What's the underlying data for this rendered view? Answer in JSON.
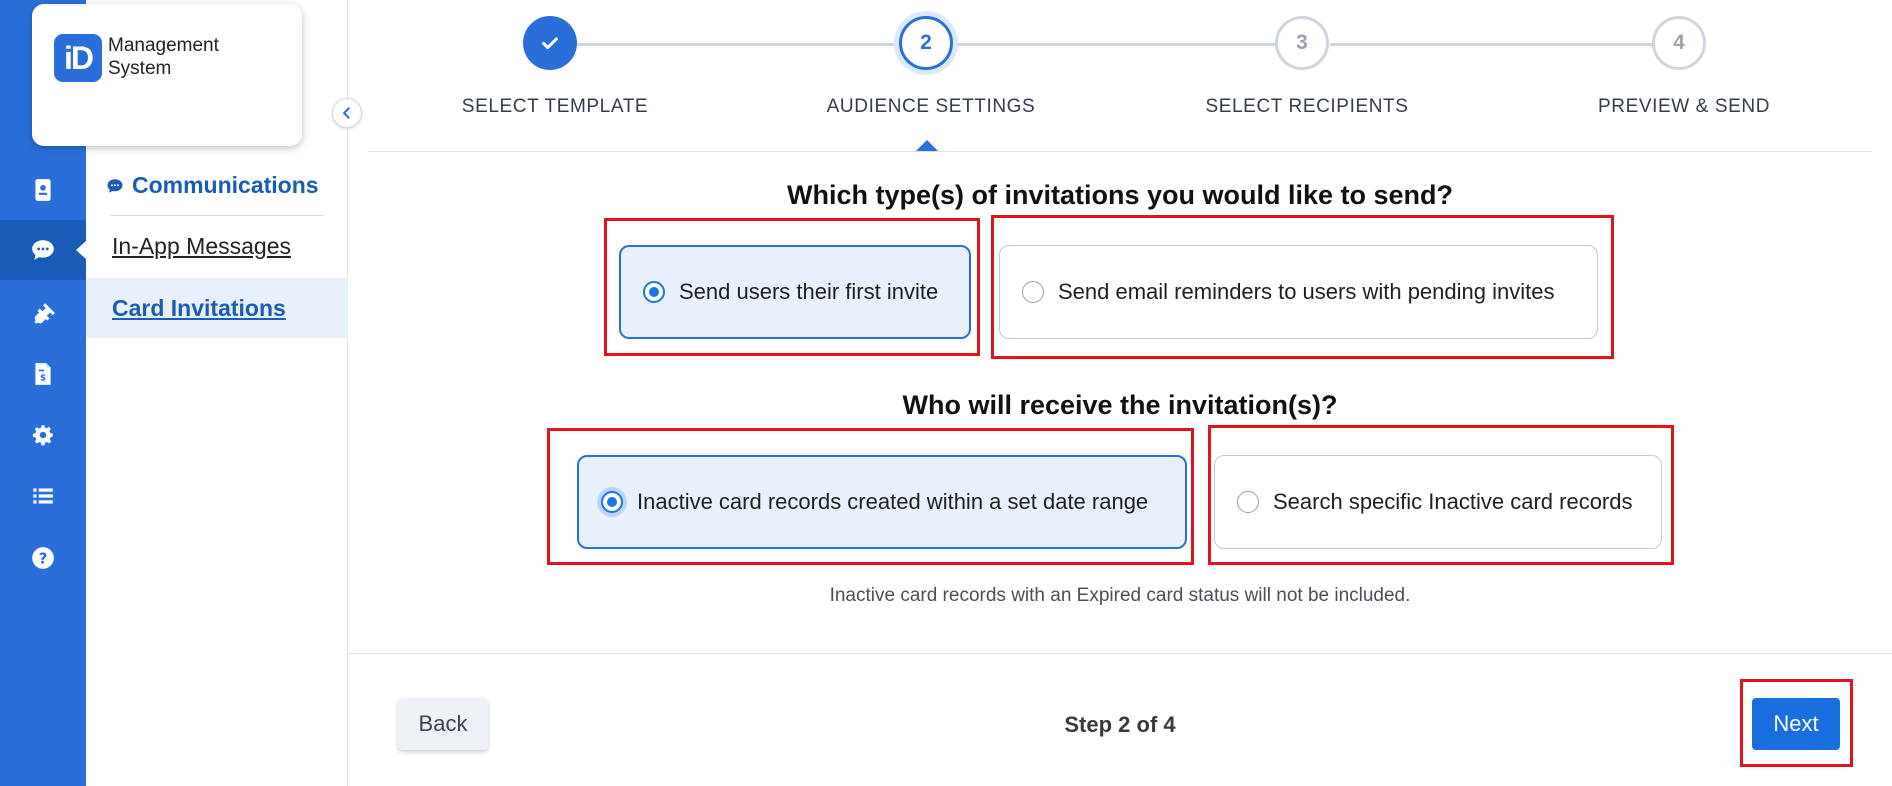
{
  "logo": {
    "badge": "iD",
    "line1": "Management",
    "line2": "System"
  },
  "rail": {
    "items": [
      {
        "icon": "id-card-icon",
        "active": false
      },
      {
        "icon": "chat-bubble-icon",
        "active": true
      },
      {
        "icon": "plug-icon",
        "active": false
      },
      {
        "icon": "invoice-icon",
        "active": false
      },
      {
        "icon": "gear-icon",
        "active": false
      },
      {
        "icon": "list-icon",
        "active": false
      },
      {
        "icon": "help-icon",
        "active": false
      }
    ]
  },
  "subnav": {
    "header": "Communications",
    "items": [
      {
        "label": "In-App Messages",
        "active": false
      },
      {
        "label": "Card Invitations",
        "active": true
      }
    ]
  },
  "stepper": {
    "steps": [
      {
        "number": "1",
        "label": "SELECT TEMPLATE",
        "state": "done"
      },
      {
        "number": "2",
        "label": "AUDIENCE SETTINGS",
        "state": "current"
      },
      {
        "number": "3",
        "label": "SELECT RECIPIENTS",
        "state": "todo"
      },
      {
        "number": "4",
        "label": "PREVIEW & SEND",
        "state": "todo"
      }
    ]
  },
  "invitation_type": {
    "question": "Which type(s) of invitations you would like to send?",
    "options": [
      {
        "label": "Send users their first invite",
        "selected": true
      },
      {
        "label": "Send email reminders to users with pending invites",
        "selected": false
      }
    ]
  },
  "recipients": {
    "question": "Who will receive the invitation(s)?",
    "options": [
      {
        "label": "Inactive card records created within a set date range",
        "selected": true
      },
      {
        "label": "Search specific Inactive card records",
        "selected": false
      }
    ],
    "note": "Inactive card records with an Expired card status will not be included."
  },
  "footer": {
    "back_label": "Back",
    "step_count": "Step 2 of 4",
    "next_label": "Next"
  },
  "colors": {
    "primary": "#2a6fd9",
    "selected_bg": "#e8f0fc",
    "highlight": "#e0141e"
  }
}
